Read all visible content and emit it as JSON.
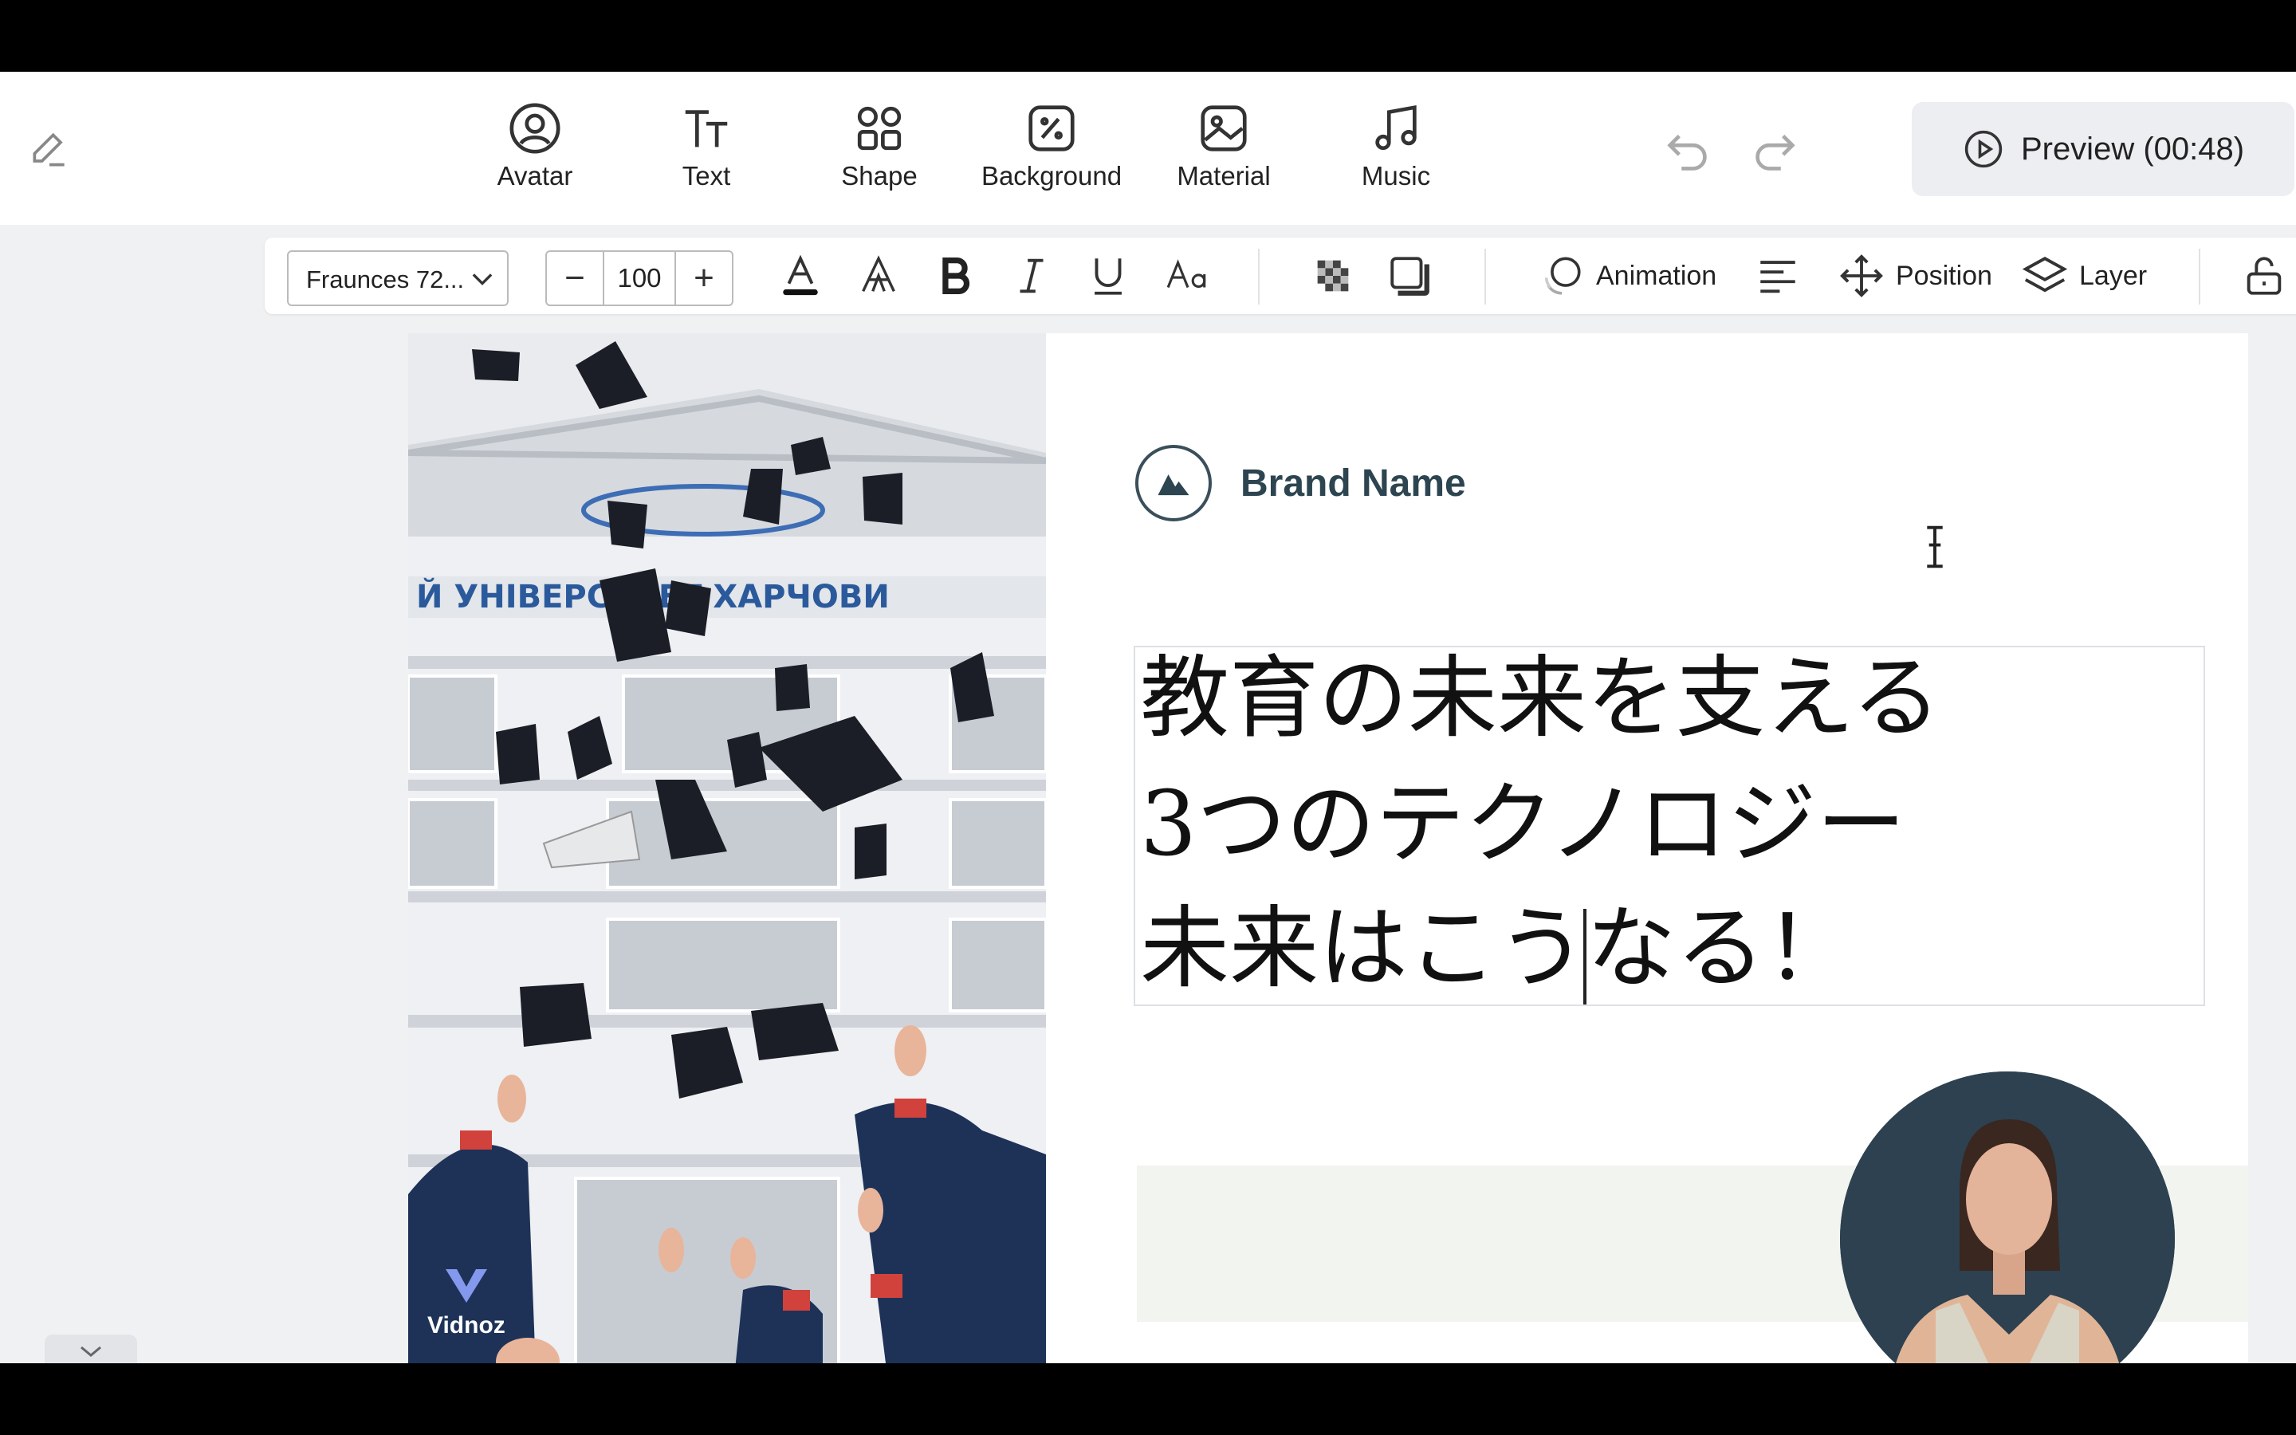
{
  "toolbar_top": {
    "items": [
      {
        "label": "Avatar",
        "icon": "avatar-icon"
      },
      {
        "label": "Text",
        "icon": "text-icon"
      },
      {
        "label": "Shape",
        "icon": "shape-icon"
      },
      {
        "label": "Background",
        "icon": "background-icon"
      },
      {
        "label": "Material",
        "icon": "material-icon"
      },
      {
        "label": "Music",
        "icon": "music-icon"
      }
    ],
    "preview_label": "Preview (00:48)"
  },
  "format_bar": {
    "font": "Fraunces 72...",
    "size": "100",
    "animation_label": "Animation",
    "position_label": "Position",
    "layer_label": "Layer"
  },
  "canvas": {
    "brand_name": "Brand Name",
    "headline": [
      "教育の未来を支える",
      "3つのテクノロジー",
      "未来はこうなる！"
    ],
    "watermark": "Vidnoz"
  },
  "colors": {
    "accent_dark": "#2d4150",
    "band": "#f2f4f0"
  }
}
